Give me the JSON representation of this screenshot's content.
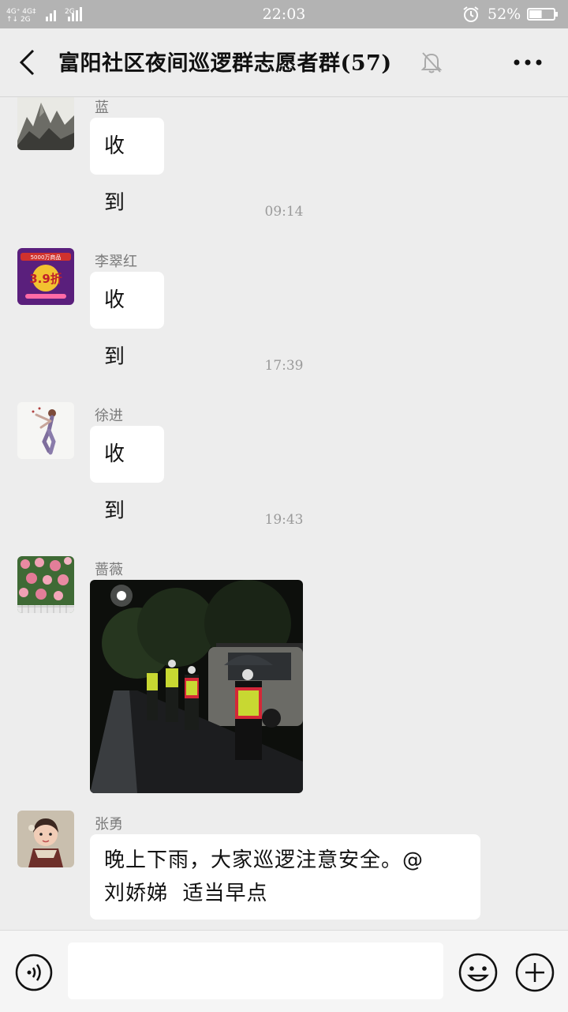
{
  "status_bar": {
    "signal_text": "4G⁺ 4G‡ 2G",
    "time": "22:03",
    "battery_percent": "52%",
    "battery_level": 0.52
  },
  "header": {
    "back_icon": "back-arrow-icon",
    "title": "富阳社区夜间巡逻群志愿者群(57)",
    "mute_icon": "muted-bell-icon",
    "more_icon": "more-dots-icon"
  },
  "messages": [
    {
      "sender": "蓝",
      "text": "收到"
    },
    {
      "timestamp": "09:14"
    },
    {
      "sender": "李翠红",
      "text": "收到"
    },
    {
      "timestamp": "17:39"
    },
    {
      "sender": "徐进",
      "text": "收到"
    },
    {
      "timestamp": "19:43"
    },
    {
      "sender": "蔷薇",
      "image": "night-patrol-photo"
    },
    {
      "sender": "张勇",
      "text_line1": "晚上下雨，大家巡逻注意安全。@",
      "text_line2": "刘娇娣  适当早点"
    }
  ],
  "avatar_badge": {
    "line1": "5000万商品",
    "line2": "3.9折"
  },
  "input_bar": {
    "voice_icon": "voice-icon",
    "input_placeholder": "",
    "emoji_icon": "emoji-icon",
    "plus_icon": "plus-icon"
  }
}
